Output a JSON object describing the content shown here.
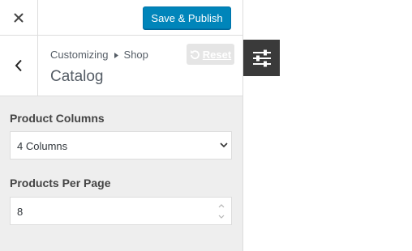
{
  "header": {
    "close_icon": "close-icon",
    "save_publish_label": "Save & Publish"
  },
  "section": {
    "back_icon": "chevron-left-icon",
    "breadcrumb": [
      "Customizing",
      "Shop"
    ],
    "breadcrumb_separator_icon": "triangle-right-icon",
    "title": "Catalog",
    "reset_label": "Reset",
    "reset_icon": "undo-icon"
  },
  "fields": {
    "product_columns": {
      "label": "Product Columns",
      "value": "4 Columns",
      "icon": "chevron-down-icon"
    },
    "products_per_page": {
      "label": "Products Per Page",
      "value": "8",
      "icon": "spinner-arrows-icon"
    }
  },
  "floating_tool": {
    "icon": "sliders-icon"
  },
  "colors": {
    "accent": "#0085ba",
    "panel_bg": "#eeeeee",
    "tool_bg": "#3a3a3a"
  }
}
